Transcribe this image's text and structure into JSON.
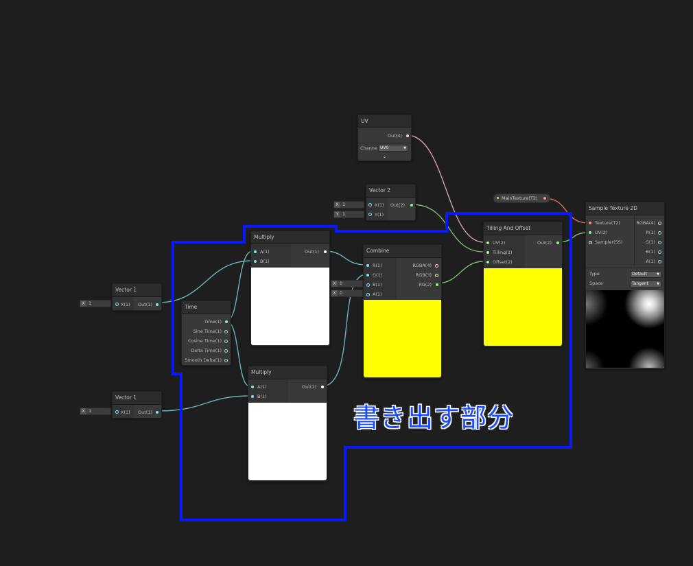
{
  "nodes": {
    "uv": {
      "title": "UV",
      "out": "Out(4)",
      "channel_label": "Channe",
      "channel_value": "UV0"
    },
    "vector2": {
      "title": "Vector 2",
      "in_x": "X(1)",
      "in_y": "Y(1)",
      "out": "Out(2)",
      "x_label": "X",
      "x_value": "1",
      "y_label": "Y",
      "y_value": "1"
    },
    "main_texture": {
      "label": "MainTexture(T2)"
    },
    "sample_texture": {
      "title": "Sample Texture 2D",
      "in_texture": "Texture(T2)",
      "in_uv": "UV(2)",
      "in_sampler": "Sampler(SS)",
      "out_rgba": "RGBA(4)",
      "out_r": "R(1)",
      "out_g": "G(1)",
      "out_b": "B(1)",
      "out_a": "A(1)",
      "type_label": "Type",
      "type_value": "Default",
      "space_label": "Space",
      "space_value": "Tangent"
    },
    "tiling_offset": {
      "title": "Tilling And Offset",
      "in_uv": "UV(2)",
      "in_tiling": "Tilling(2)",
      "in_offset": "Offset(2)",
      "out": "Out(2)"
    },
    "combine": {
      "title": "Combine",
      "in_r": "R(1)",
      "in_g": "G(1)",
      "in_b": "B(1)",
      "in_a": "A(1)",
      "out_rgba": "RGBA(4)",
      "out_rgb": "RGB(3)",
      "out_rg": "RG(2)",
      "b_label": "X",
      "b_value": "0",
      "a_label": "X",
      "a_value": "0"
    },
    "multiply1": {
      "title": "Multiply",
      "in_a": "A(1)",
      "in_b": "B(1)",
      "out": "Out(1)"
    },
    "multiply2": {
      "title": "Multiply",
      "in_a": "A(1)",
      "in_b": "B(1)",
      "out": "Out(1)"
    },
    "time": {
      "title": "Time",
      "out_time": "Time(1)",
      "out_sine": "Sine Time(1)",
      "out_cosine": "Cosine Time(1)",
      "out_delta": "Delta Time(1)",
      "out_smooth": "Smooth Delta(1)"
    },
    "vector1a": {
      "title": "Vector 1",
      "in_x": "X(1)",
      "out": "Out(1)",
      "x_label": "X",
      "x_value": "1"
    },
    "vector1b": {
      "title": "Vector 1",
      "in_x": "X(1)",
      "out": "Out(1)",
      "x_label": "X",
      "x_value": "1"
    }
  },
  "annotation": {
    "text": "書き出す部分",
    "color": "#1a4bff"
  },
  "colors": {
    "port_float": "#84e4e7",
    "port_vec2": "#9aef92",
    "port_vec3": "#f6ff9a",
    "port_vec4": "#fcd6e2",
    "port_texture": "#ff8b8b",
    "wire_float": "#6fb4b5",
    "wire_vec2": "#7fba78",
    "wire_vec4": "#c5a7b0",
    "wire_texture": "#d67070",
    "preview_yellow": "#ffff00",
    "preview_white": "#ffffff"
  }
}
